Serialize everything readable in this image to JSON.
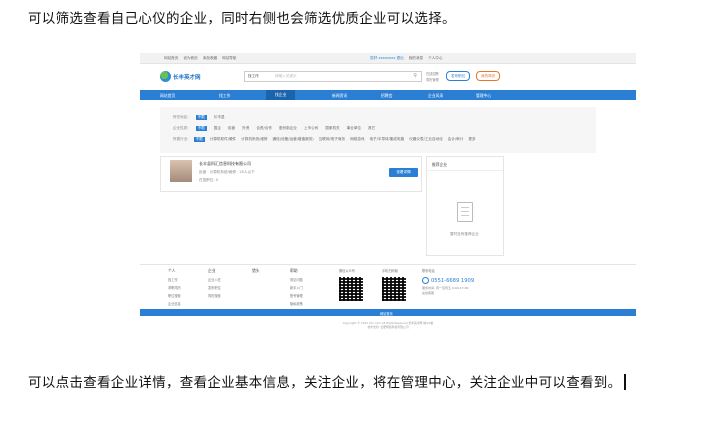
{
  "text": {
    "para1": "可以筛选查看自己心仪的企业，同时右侧也会筛选优质企业可以选择。",
    "para2": "可以点击查看企业详情，查看企业基本信息，关注企业，将在管理中心，关注企业中可以查看到。"
  },
  "screenshot": {
    "topbar": {
      "left": [
        "网站首页",
        "设为首页",
        "添加收藏",
        "网站导航"
      ],
      "right": [
        "您好 xxxxxxxx 退出",
        "我的消息",
        "个人中心"
      ]
    },
    "logo": "长丰英才网",
    "search": {
      "select": "找工作",
      "placeholder": "请输入关键字",
      "icon": "search-icon"
    },
    "header_links": [
      "在线招聘",
      "简历管理"
    ],
    "buttons": {
      "post": "发布职位",
      "resume": "我的简历"
    },
    "nav": [
      "网站首页",
      "找工作",
      "找企业",
      "新闻资讯",
      "招聘会",
      "企业风采",
      "管理中心"
    ],
    "filters": [
      {
        "label": "所在地区:",
        "options": [
          "不限",
          "长丰县"
        ]
      },
      {
        "label": "企业性质:",
        "options": [
          "不限",
          "国企",
          "民营",
          "外资",
          "合资/合作",
          "股份制企业",
          "上市公司",
          "国家机关",
          "事业单位",
          "其它"
        ]
      },
      {
        "label": "所属行业:",
        "options": [
          "不限",
          "计算机软件/硬件",
          "计算机系统/维修",
          "通信(设备/运营/增值服务)",
          "互联网/电子商务",
          "网络游戏",
          "电子/半导体/集成电路",
          "仪器仪表/工业自动化",
          "会计/审计",
          "更多"
        ]
      }
    ],
    "company": {
      "name": "长丰县科汇信息科技有限公司",
      "meta": "民营 · 计算机系统/维修 · 20人以下",
      "meta2": "在招职位: 0",
      "button": "查看详情"
    },
    "sidebar": {
      "title": "推荐企业",
      "empty": "暂时没有推荐企业"
    },
    "footer": {
      "columns": [
        {
          "title": "个人",
          "items": [
            "找工作",
            "求职简历",
            "职位搜索",
            "企业信息"
          ]
        },
        {
          "title": "企业",
          "items": [
            "企业入驻",
            "发布职位",
            "简历搜索"
          ]
        },
        {
          "title": "猎头",
          "items": []
        },
        {
          "title": "帮助",
          "items": [
            "常见问题",
            "新手入门",
            "账号管理",
            "隐私政策"
          ]
        }
      ],
      "qr_labels": [
        "微信公众号",
        "手机扫码版"
      ],
      "service_title": "联系电话",
      "phone": "0551-6689 1909",
      "service_note": [
        "服务时间: 周一至周五 9:00-17:00",
        "在线客服"
      ],
      "bar": "网站首页",
      "copyright": "Copyright © 2015 cfrc.com All Right Reserved  长丰英才网  皖ICP备",
      "copyright2": "技术支持: 合肥网络科技有限公司"
    }
  }
}
